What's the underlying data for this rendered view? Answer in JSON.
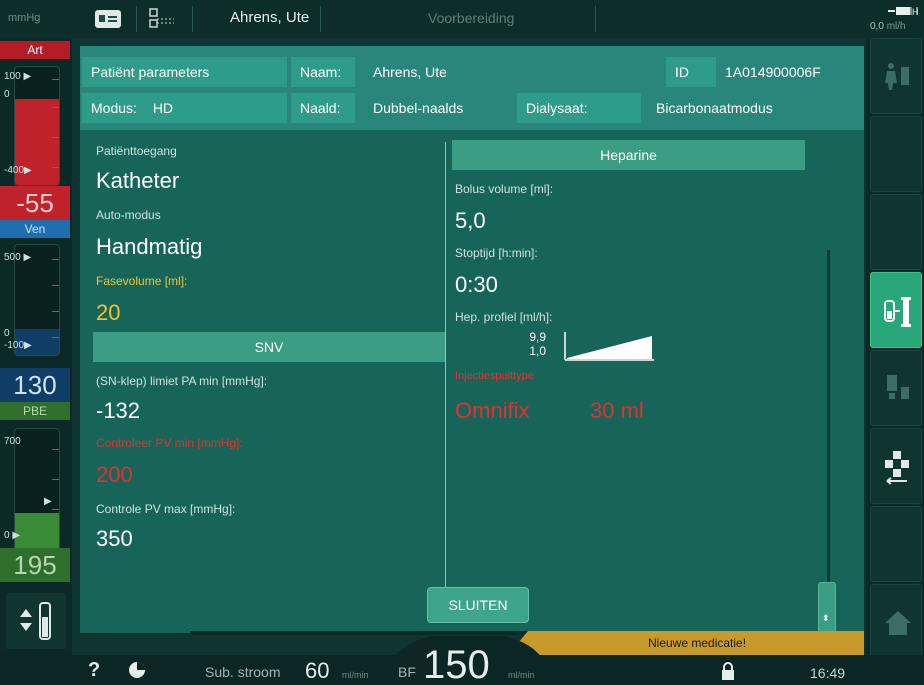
{
  "topbar": {
    "unit": "mmHg",
    "patient_name": "Ahrens, Ute",
    "phase": "Voorbereiding",
    "uf_value": "0,0",
    "uf_unit": "ml/h",
    "icons": [
      "card-icon",
      "network-icon",
      "battery-icon"
    ]
  },
  "left_column": {
    "art": {
      "label": "Art",
      "scale_top": "100",
      "scale_zero": "0",
      "scale_bottom": "-400",
      "value": "-55",
      "color": "#c8202a"
    },
    "ven": {
      "label": "Ven",
      "scale_top": "500",
      "scale_zero": "0",
      "scale_bottom": "-100",
      "value": "130",
      "color": "#1d6fb0"
    },
    "pbe": {
      "label": "PBE",
      "scale_top": "700",
      "scale_zero": "0",
      "value": "195",
      "color": "#3a8b36"
    }
  },
  "header": {
    "patient_params_label": "Patiënt parameters",
    "naam_label": "Naam:",
    "naam_value": "Ahrens, Ute",
    "id_label": "ID",
    "id_value": "1A014900006F",
    "modus_label": "Modus:",
    "modus_value": "HD",
    "naald_label": "Naald:",
    "naald_value": "Dubbel-naalds",
    "dialysaat_label": "Dialysaat:",
    "dialysaat_value": "Bicarbonaatmodus"
  },
  "left_panel": {
    "patienttoegang_label": "Patiënttoegang",
    "patienttoegang_value": "Katheter",
    "automodus_label": "Auto-modus",
    "automodus_value": "Handmatig",
    "fasevolume_label": "Fasevolume [ml]:",
    "fasevolume_value": "20",
    "snv_title": "SNV",
    "limiet_label": "(SN-klep) limiet PA min [mmHg]:",
    "limiet_value": "-132",
    "controleer_label": "Controleer PV min [mmHg]:",
    "controleer_value": "200",
    "controle_max_label": "Controle PV max [mmHg]:",
    "controle_max_value": "350"
  },
  "right_panel": {
    "title": "Heparine",
    "bolus_label": "Bolus volume [ml]:",
    "bolus_value": "5,0",
    "stoptijd_label": "Stoptijd [h:min]:",
    "stoptijd_value": "0:30",
    "profiel_label": "Hep. profiel [ml/h]:",
    "profiel_high": "9,9",
    "profiel_low": "1,0",
    "spuit_label": "Injectiespuittype",
    "spuit_value": "Omnifix",
    "spuit_size": "30 ml"
  },
  "close_button": "SLUITEN",
  "alert": "Nieuwe medicatie!",
  "bottombar": {
    "help": "?",
    "sub_label": "Sub. stroom",
    "sub_value": "60",
    "sub_unit": "ml/min",
    "bf_label": "BF",
    "bf_value": "150",
    "bf_unit": "ml/min",
    "time": "16:49"
  },
  "colors": {
    "dialog_bg": "#176559",
    "header_box": "#2f9c8a",
    "section_bar": "#3b9d83",
    "warning_yellow": "#f2c230",
    "alarm_red": "#e0322e",
    "alert_bar": "#c79a2c",
    "active_button": "#2aa779"
  }
}
